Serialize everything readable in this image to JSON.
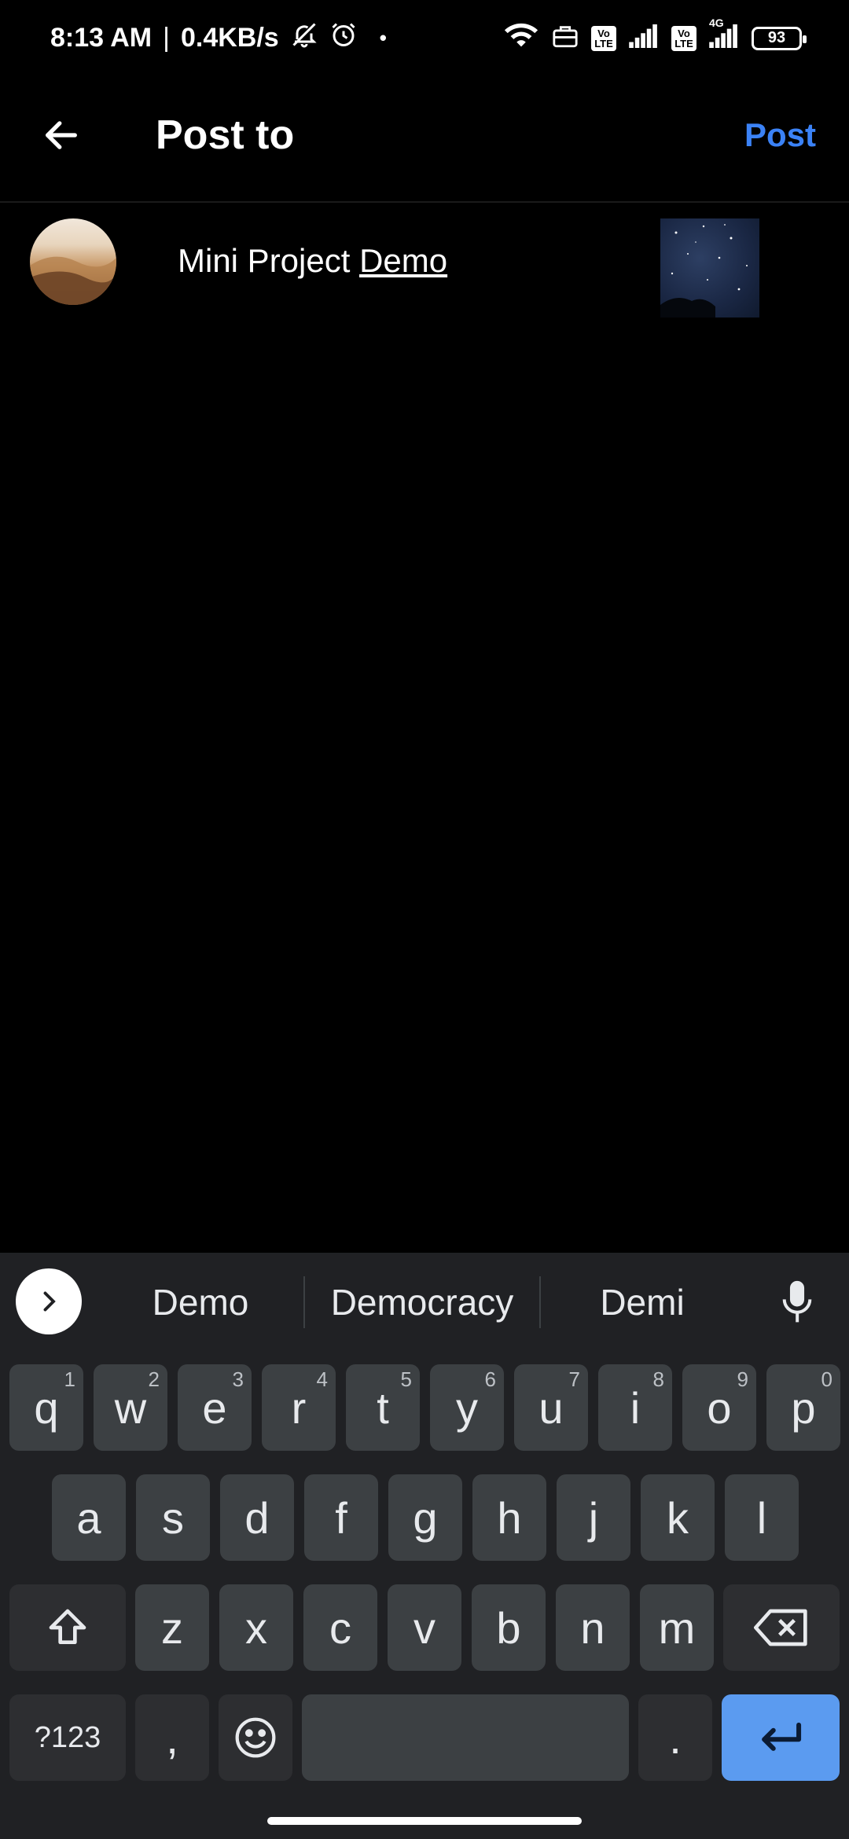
{
  "status_bar": {
    "time": "8:13 AM",
    "separator": "|",
    "speed": "0.4KB/s",
    "dot": "•",
    "icons": [
      "bell-muted-icon",
      "alarm-icon",
      "wifi-icon",
      "briefcase-icon",
      "volte-icon",
      "signal-icon",
      "volte-icon",
      "4g-signal-icon"
    ],
    "volte_label": "Vo LTE",
    "net_label": "4G",
    "battery": "93"
  },
  "app_bar": {
    "title": "Post to",
    "post_label": "Post"
  },
  "post": {
    "caption_plain": "Mini Project ",
    "caption_underlined": "Demo"
  },
  "keyboard": {
    "suggestions": [
      "Demo",
      "Democracy",
      "Demi"
    ],
    "row1": [
      {
        "k": "q",
        "h": "1"
      },
      {
        "k": "w",
        "h": "2"
      },
      {
        "k": "e",
        "h": "3"
      },
      {
        "k": "r",
        "h": "4"
      },
      {
        "k": "t",
        "h": "5"
      },
      {
        "k": "y",
        "h": "6"
      },
      {
        "k": "u",
        "h": "7"
      },
      {
        "k": "i",
        "h": "8"
      },
      {
        "k": "o",
        "h": "9"
      },
      {
        "k": "p",
        "h": "0"
      }
    ],
    "row2": [
      "a",
      "s",
      "d",
      "f",
      "g",
      "h",
      "j",
      "k",
      "l"
    ],
    "row3": [
      "z",
      "x",
      "c",
      "v",
      "b",
      "n",
      "m"
    ],
    "symbols_label": "?123",
    "comma": ",",
    "period": ".",
    "accent_color": "#5b9bf0"
  }
}
